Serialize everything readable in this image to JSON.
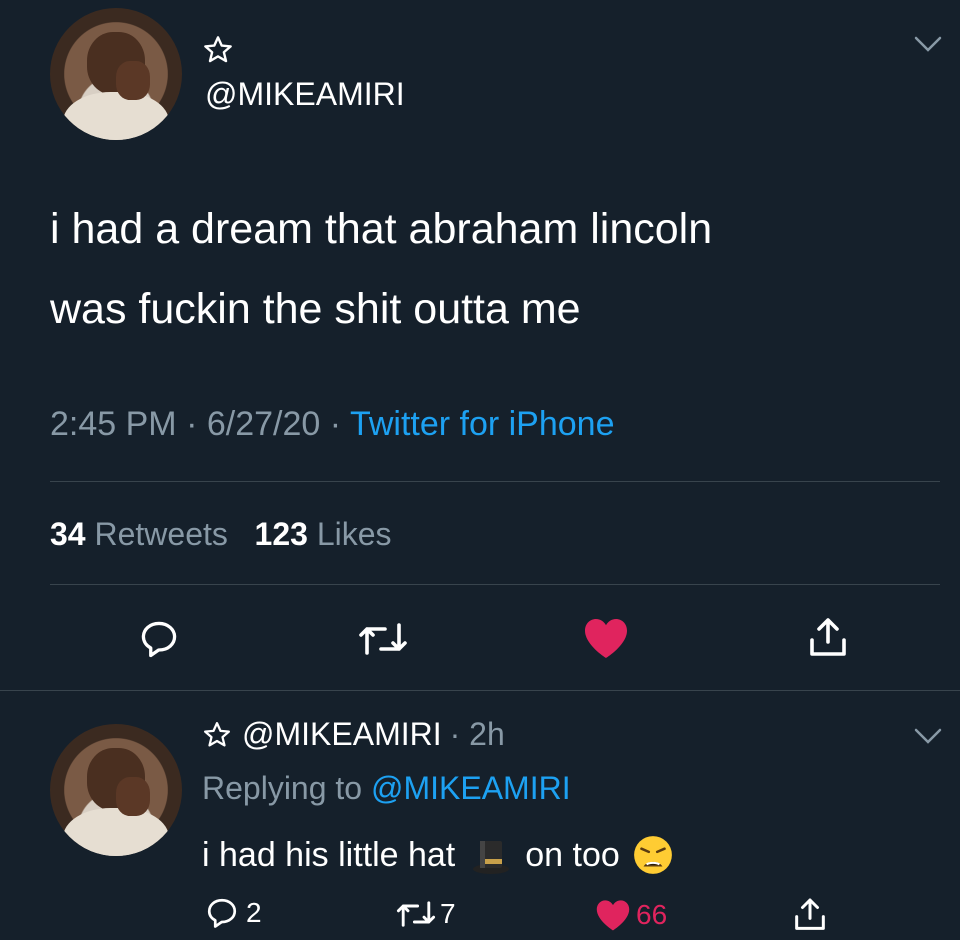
{
  "tweet": {
    "handle": "@MIKEAMIRI",
    "text_line1": "i had a dream that abraham lincoln",
    "text_line2": "was fuckin the shit outta me",
    "time": "2:45 PM",
    "date": "6/27/20",
    "separator": "·",
    "source": "Twitter for iPhone",
    "retweets_count": "34",
    "retweets_label": "Retweets",
    "likes_count": "123",
    "likes_label": "Likes"
  },
  "reply": {
    "handle": "@MIKEAMIRI",
    "time_ago": "· 2h",
    "replying_to_label": "Replying to",
    "replying_to_handle": "@MIKEAMIRI",
    "text_before": "i had his little hat",
    "text_after": "on too",
    "reply_count": "2",
    "retweet_count": "7",
    "like_count": "66"
  },
  "icons": {
    "star": "star-icon",
    "chevron": "chevron-down-icon",
    "reply": "reply-icon",
    "retweet": "retweet-icon",
    "like": "heart-icon",
    "share": "share-icon",
    "tophat": "top-hat-emoji",
    "weary": "weary-face-emoji"
  },
  "colors": {
    "background": "#15202b",
    "link": "#1da1f2",
    "muted": "#8899a6",
    "like": "#e0245e",
    "divider": "#38444d"
  }
}
